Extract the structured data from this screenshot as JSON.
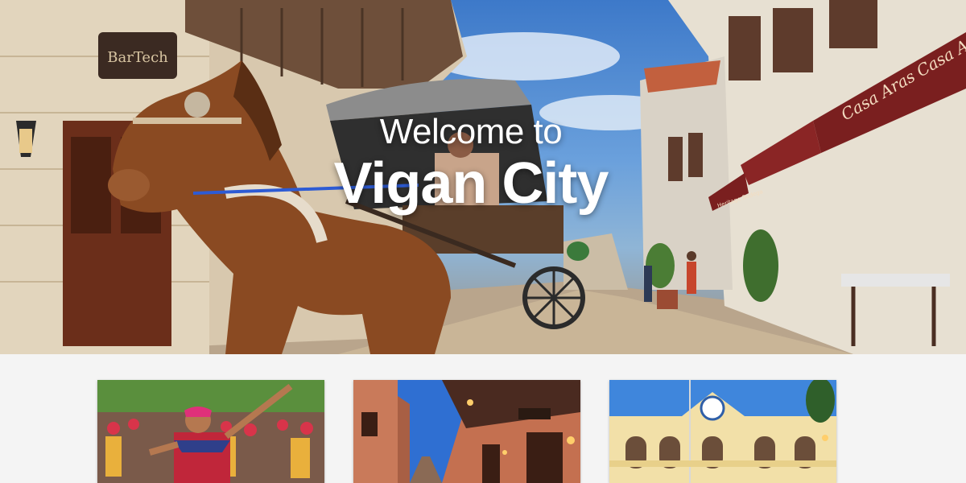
{
  "hero": {
    "title_line1": "Welcome to",
    "title_line2": "Vigan City",
    "signs": {
      "bartech": "BarTech",
      "awning": "Casa Aras Casa Aras",
      "heritage": "Heritage Bodega"
    }
  },
  "cards": [
    {
      "subject": "festival dancers"
    },
    {
      "subject": "calle crisologo street at dusk"
    },
    {
      "subject": "city hall"
    }
  ],
  "colors": {
    "page_bg": "#f4f4f4",
    "title_text": "#ffffff",
    "awning": "#7a1f1f"
  }
}
